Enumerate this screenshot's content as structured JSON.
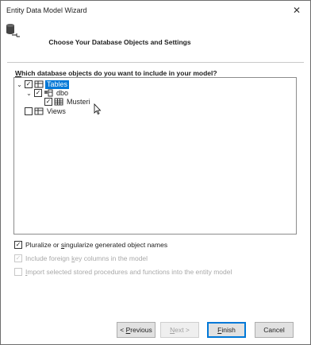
{
  "window": {
    "title": "Entity Data Model Wizard",
    "close_glyph": "✕"
  },
  "header": {
    "title": "Choose Your Database Objects and Settings"
  },
  "question": {
    "accesskey": "W",
    "rest": "hich database objects do you want to include in your model?"
  },
  "tree": {
    "nodes": [
      {
        "label": "Tables",
        "checked": true,
        "expanded": true,
        "selected": true,
        "icon": "tables-icon"
      },
      {
        "label": "dbo",
        "checked": true,
        "expanded": true,
        "icon": "schema-icon"
      },
      {
        "label": "Musteri",
        "checked": true,
        "icon": "table-icon"
      },
      {
        "label": "Views",
        "checked": false,
        "icon": "views-icon"
      }
    ]
  },
  "options": [
    {
      "pre": "Pluralize or ",
      "ak": "s",
      "post": "ingularize generated object names",
      "checked": true,
      "enabled": true
    },
    {
      "pre": "Include foreign ",
      "ak": "k",
      "post": "ey columns in the model",
      "checked": true,
      "enabled": false
    },
    {
      "pre": "",
      "ak": "I",
      "post": "mport selected stored procedures and functions into the entity model",
      "checked": false,
      "enabled": false
    }
  ],
  "buttons": {
    "previous": {
      "pre": "< ",
      "ak": "P",
      "post": "revious"
    },
    "next": {
      "pre": "",
      "ak": "N",
      "post": "ext >"
    },
    "finish": {
      "pre": "",
      "ak": "F",
      "post": "inish"
    },
    "cancel": {
      "label": "Cancel"
    }
  },
  "glyphs": {
    "expanded": "⌄",
    "check": "✓"
  },
  "colors": {
    "selection": "#0078d7",
    "primary_border": "#0078d7"
  }
}
